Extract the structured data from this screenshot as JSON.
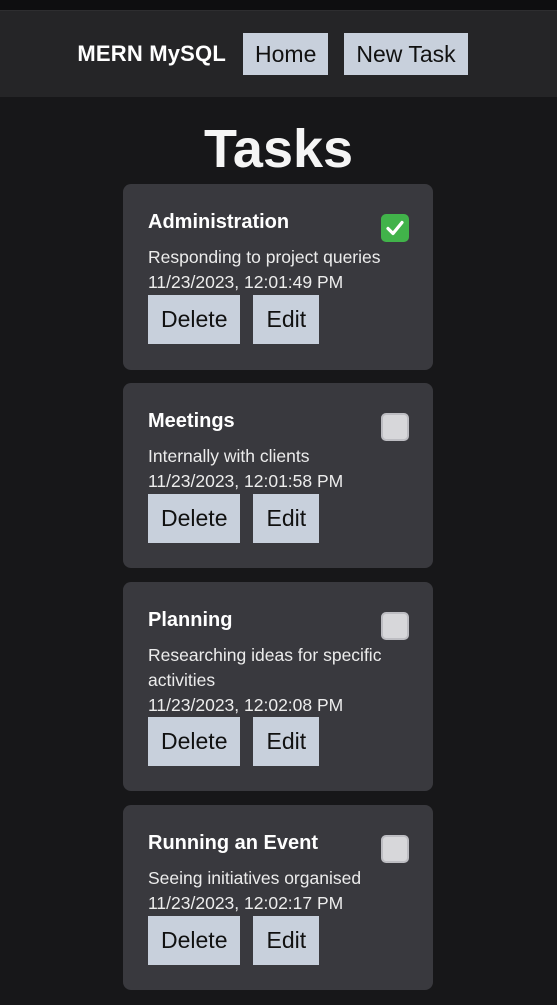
{
  "nav": {
    "brand": "MERN MySQL",
    "home_label": "Home",
    "new_task_label": "New Task"
  },
  "page": {
    "title": "Tasks"
  },
  "tasks": [
    {
      "title": "Administration",
      "description": "Responding to project queries",
      "created": "11/23/2023, 12:01:49 PM",
      "done": true,
      "delete_label": "Delete",
      "edit_label": "Edit"
    },
    {
      "title": "Meetings",
      "description": "Internally with clients",
      "created": "11/23/2023, 12:01:58 PM",
      "done": false,
      "delete_label": "Delete",
      "edit_label": "Edit"
    },
    {
      "title": "Planning",
      "description": "Researching ideas for specific activities",
      "created": "11/23/2023, 12:02:08 PM",
      "done": false,
      "delete_label": "Delete",
      "edit_label": "Edit"
    },
    {
      "title": "Running an Event",
      "description": "Seeing initiatives organised",
      "created": "11/23/2023, 12:02:17 PM",
      "done": false,
      "delete_label": "Delete",
      "edit_label": "Edit"
    }
  ],
  "icons": {
    "done": "check-mark-button-icon",
    "todo": "empty-checkbox-icon"
  },
  "colors": {
    "background": "#171719",
    "navbar": "#252527",
    "card": "#39393e",
    "button": "#c8d0dc",
    "done_check": "#41b34a"
  }
}
